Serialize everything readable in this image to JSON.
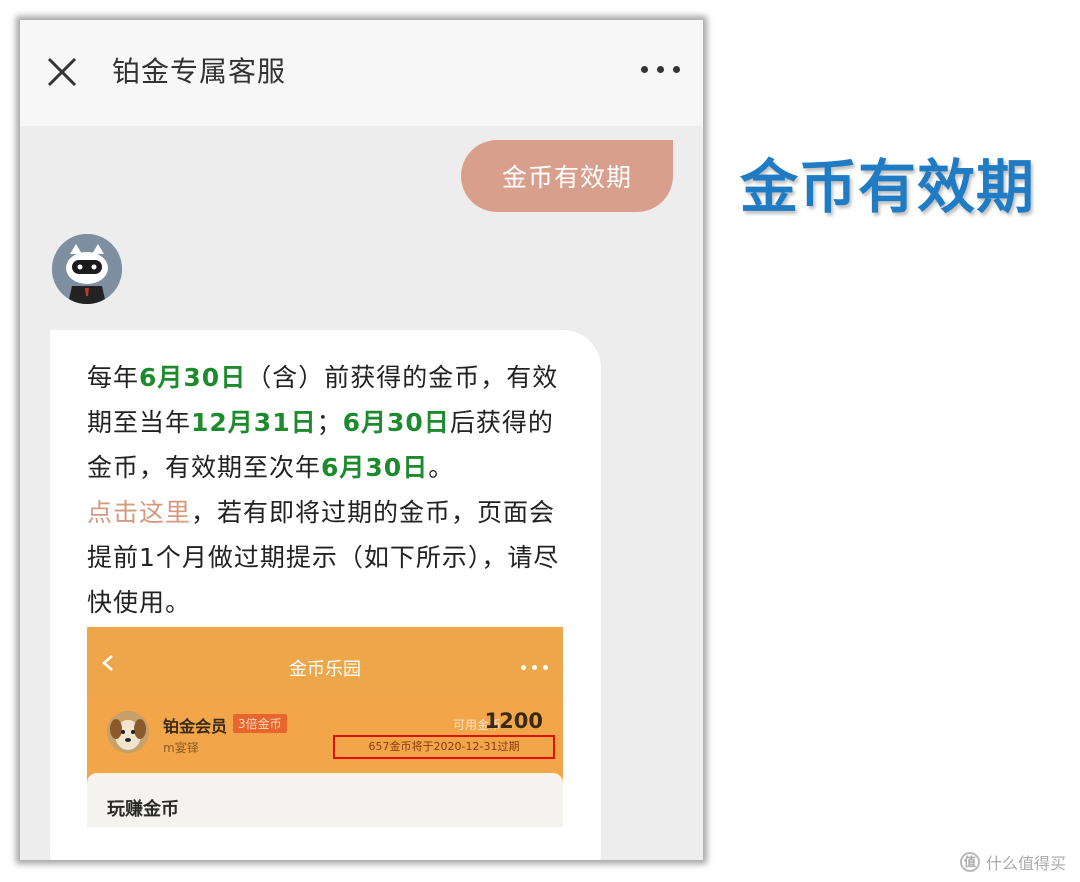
{
  "topbar": {
    "title": "铂金专属客服"
  },
  "user_message": "金币有效期",
  "bot_message": {
    "p1_a": "每年",
    "p1_date1": "6月30日",
    "p1_b": "（含）前获得的金币，有效期至当年",
    "p1_date2": "12月31日",
    "p1_c": "；",
    "p1_date3": "6月30日",
    "p1_d": "后获得的金币，有效期至次年",
    "p1_date4": "6月30日",
    "p1_e": "。",
    "link": "点击这里",
    "p2": "，若有即将过期的金币，页面会提前1个月做过期提示（如下所示），请尽快使用。"
  },
  "embedded": {
    "title": "金币乐园",
    "member_name": "铂金会员",
    "badge": "3倍金币",
    "sub": "m宴铎",
    "balance_label": "可用金币",
    "balance": "1200",
    "expire_notice": "657金币将于2020-12-31过期",
    "section_title": "玩赚金币"
  },
  "side_title": "金币有效期",
  "watermark": "什么值得买",
  "colors": {
    "accent_green": "#1c8a2d",
    "bubble": "#d8a08c",
    "side_title": "#1e7bc4"
  }
}
